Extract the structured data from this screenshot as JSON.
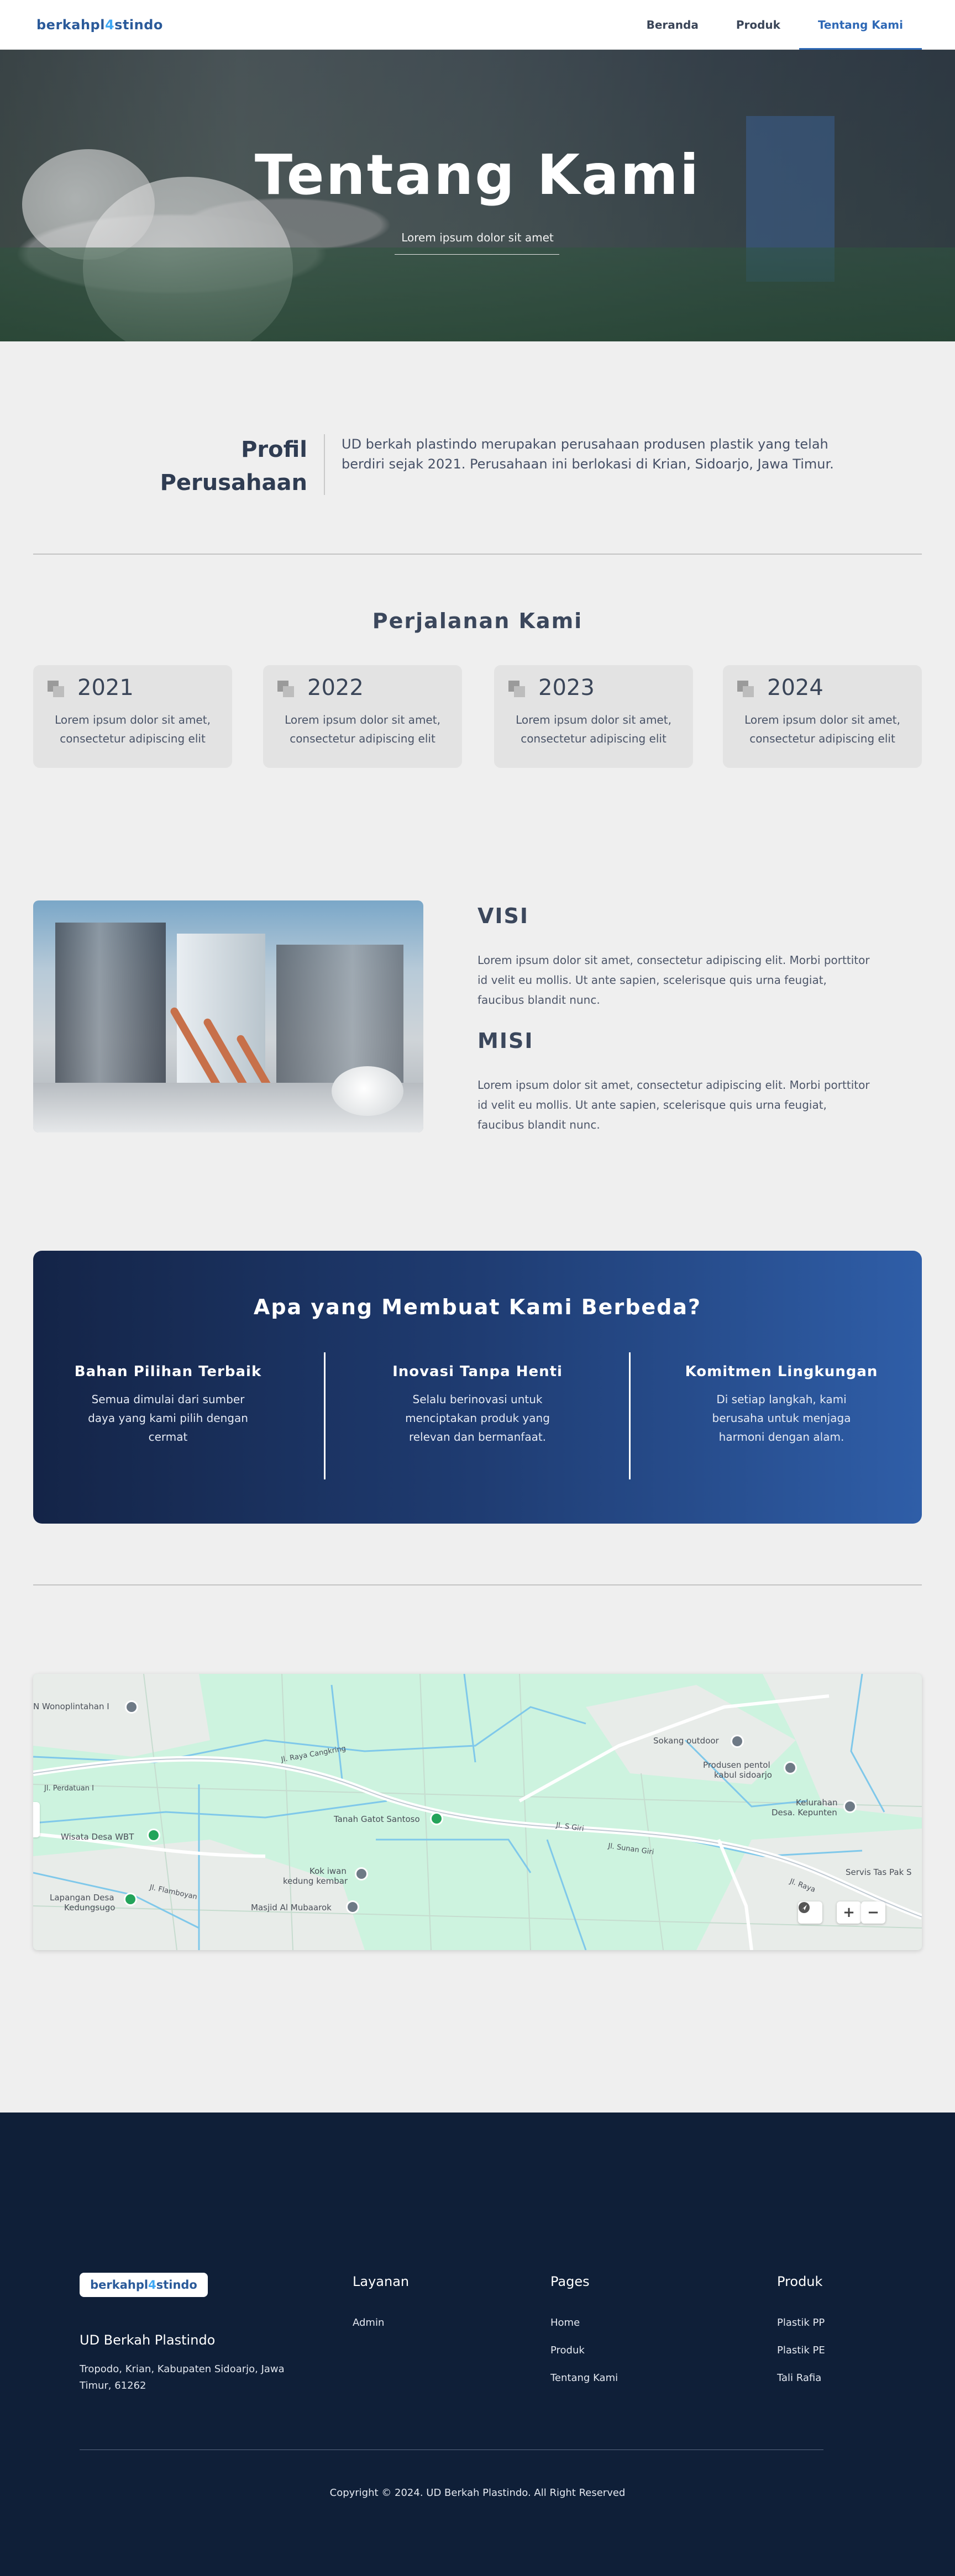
{
  "nav": {
    "logo": "berkahpl´stindo",
    "logo_main": "berkahpl",
    "logo_accent": "4",
    "logo_rest": "stindo",
    "links": [
      "Beranda",
      "Produk",
      "Tentang Kami"
    ],
    "active": "Tentang Kami"
  },
  "hero": {
    "title": "Tentang Kami",
    "subtitle": "Lorem ipsum dolor sit amet"
  },
  "profile": {
    "title_line1": "Profil",
    "title_line2": "Perusahaan",
    "text": "UD berkah plastindo merupakan perusahaan produsen plastik yang telah berdiri sejak 2021. Perusahaan ini berlokasi di Krian, Sidoarjo, Jawa Timur."
  },
  "journey": {
    "title": "Perjalanan Kami",
    "cards": [
      {
        "year": "2021",
        "text": "Lorem ipsum dolor sit amet, consectetur adipiscing elit"
      },
      {
        "year": "2022",
        "text": "Lorem ipsum dolor sit amet, consectetur adipiscing elit"
      },
      {
        "year": "2023",
        "text": "Lorem ipsum dolor sit amet, consectetur adipiscing elit"
      },
      {
        "year": "2024",
        "text": "Lorem ipsum dolor sit amet, consectetur adipiscing elit"
      }
    ]
  },
  "visi_misi": {
    "visi_title": "VISI",
    "visi_text": "Lorem ipsum dolor sit amet, consectetur adipiscing elit. Morbi porttitor id velit eu mollis. Ut ante sapien, scelerisque quis urna feugiat, faucibus blandit nunc.",
    "misi_title": "MISI",
    "misi_text": "Lorem ipsum dolor sit amet, consectetur adipiscing elit. Morbi porttitor id velit eu mollis. Ut ante sapien, scelerisque quis urna feugiat, faucibus blandit nunc."
  },
  "different": {
    "title": "Apa yang Membuat Kami Berbeda?",
    "columns": [
      {
        "heading": "Bahan Pilihan Terbaik",
        "text": "Semua dimulai dari sumber daya yang kami pilih dengan cermat"
      },
      {
        "heading": "Inovasi Tanpa Henti",
        "text": "Selalu berinovasi untuk menciptakan produk yang relevan dan bermanfaat."
      },
      {
        "heading": "Komitmen Lingkungan",
        "text": "Di setiap langkah, kami berusaha untuk menjaga harmoni dengan alam."
      }
    ]
  },
  "map": {
    "labels": {
      "wonoplintahan": "N Wonoplintahan I",
      "perdatuan": "Jl. Perdatuan I",
      "raya_cangkring": "Jl. Raya Cangkring",
      "sokang": "Sokang outdoor",
      "produsen": "Produsen pentol",
      "produsen2": "kabul sidoarjo",
      "kelurahan": "Kelurahan",
      "kelurahan2": "Desa. Kepunten",
      "tanah": "Tanah Gatot Santoso",
      "jl_s": "Jl. S Giri",
      "jl_sunan": "Jl. Sunan Giri",
      "wisata": "Wisata Desa WBT",
      "kok_iwan": "Kok iwan",
      "kok_iwan2": "kedung kembar",
      "flamboyan": "Jl. Flamboyan",
      "lapangan": "Lapangan Desa",
      "lapangan2": "Kedungsugo",
      "masjid": "Masjid Al Mubaarok",
      "servis": "Servis Tas Pak S",
      "raya": "Jl. Raya"
    },
    "zoom_in": "+",
    "zoom_out": "−"
  },
  "footer": {
    "logo_main": "berkahpl",
    "logo_accent": "4",
    "logo_rest": "stindo",
    "company": "UD Berkah Plastindo",
    "address": "Tropodo, Krian, Kabupaten Sidoarjo, Jawa Timur, 61262",
    "layanan_title": "Layanan",
    "layanan_items": [
      "Admin"
    ],
    "pages_title": "Pages",
    "pages_items": [
      "Home",
      "Produk",
      "Tentang Kami"
    ],
    "produk_title": "Produk",
    "produk_items": [
      "Plastik PP",
      "Plastik PE",
      "Tali Rafia"
    ],
    "copyright": "Copyright © 2024. UD Berkah Plastindo. All Right Reserved"
  },
  "colors": {
    "nav_active": "#2f69b6",
    "footer_bg": "#0f1f38",
    "diff_gradient_start": "#142447",
    "diff_gradient_end": "#2f5ea8",
    "page_bg": "#efefef"
  }
}
